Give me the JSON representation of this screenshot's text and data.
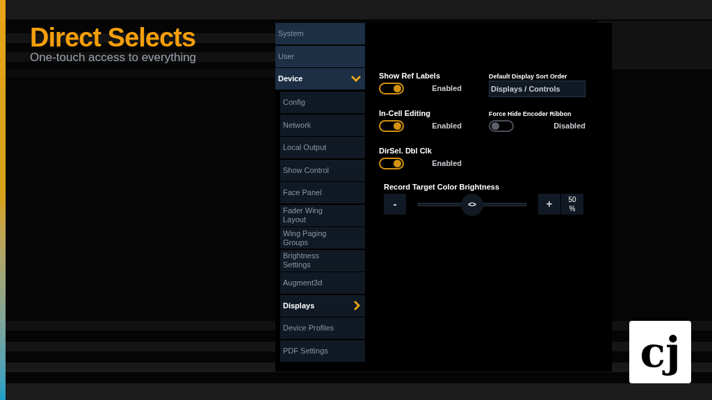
{
  "header": {
    "title": "Direct Selects",
    "subtitle": "One-touch access to everything"
  },
  "sidebar": {
    "items": [
      {
        "label": "System",
        "selected": false,
        "expanded": false
      },
      {
        "label": "User",
        "selected": false,
        "expanded": false
      },
      {
        "label": "Device",
        "selected": true,
        "expanded": true,
        "children": [
          {
            "label": "Config",
            "selected": false
          },
          {
            "label": "Network",
            "selected": false
          },
          {
            "label": "Local Output",
            "selected": false
          },
          {
            "label": "Show Control",
            "selected": false
          },
          {
            "label": "Face Panel",
            "selected": false
          },
          {
            "label": "Fader Wing Layout",
            "selected": false
          },
          {
            "label": "Wing Paging Groups",
            "selected": false
          },
          {
            "label": "Brightness Settings",
            "selected": false
          },
          {
            "label": "Augment3d",
            "selected": false
          },
          {
            "label": "Displays",
            "selected": true
          },
          {
            "label": "Device Profiles",
            "selected": false
          },
          {
            "label": "PDF Settings",
            "selected": false
          }
        ]
      }
    ]
  },
  "settings": [
    {
      "kind": "toggle",
      "label": "Show Ref Labels",
      "on": true,
      "state": "Enabled"
    },
    {
      "kind": "dropdown",
      "label": "Default Display Sort Order",
      "value": "Displays / Controls"
    },
    {
      "kind": "toggle",
      "label": "In-Cell Editing",
      "on": true,
      "state": "Enabled"
    },
    {
      "kind": "toggle",
      "label": "Force Hide Encoder Ribbon",
      "on": false,
      "state": "Disabled"
    },
    {
      "kind": "toggle",
      "label": "DirSel. Dbl Clk",
      "on": true,
      "state": "Enabled"
    }
  ],
  "brightness": {
    "label": "Record Target Color Brightness",
    "minus": "-",
    "plus": "+",
    "thumb": "<>",
    "level": 0.5,
    "value": "50 %"
  },
  "logo": {
    "text": "cj"
  }
}
